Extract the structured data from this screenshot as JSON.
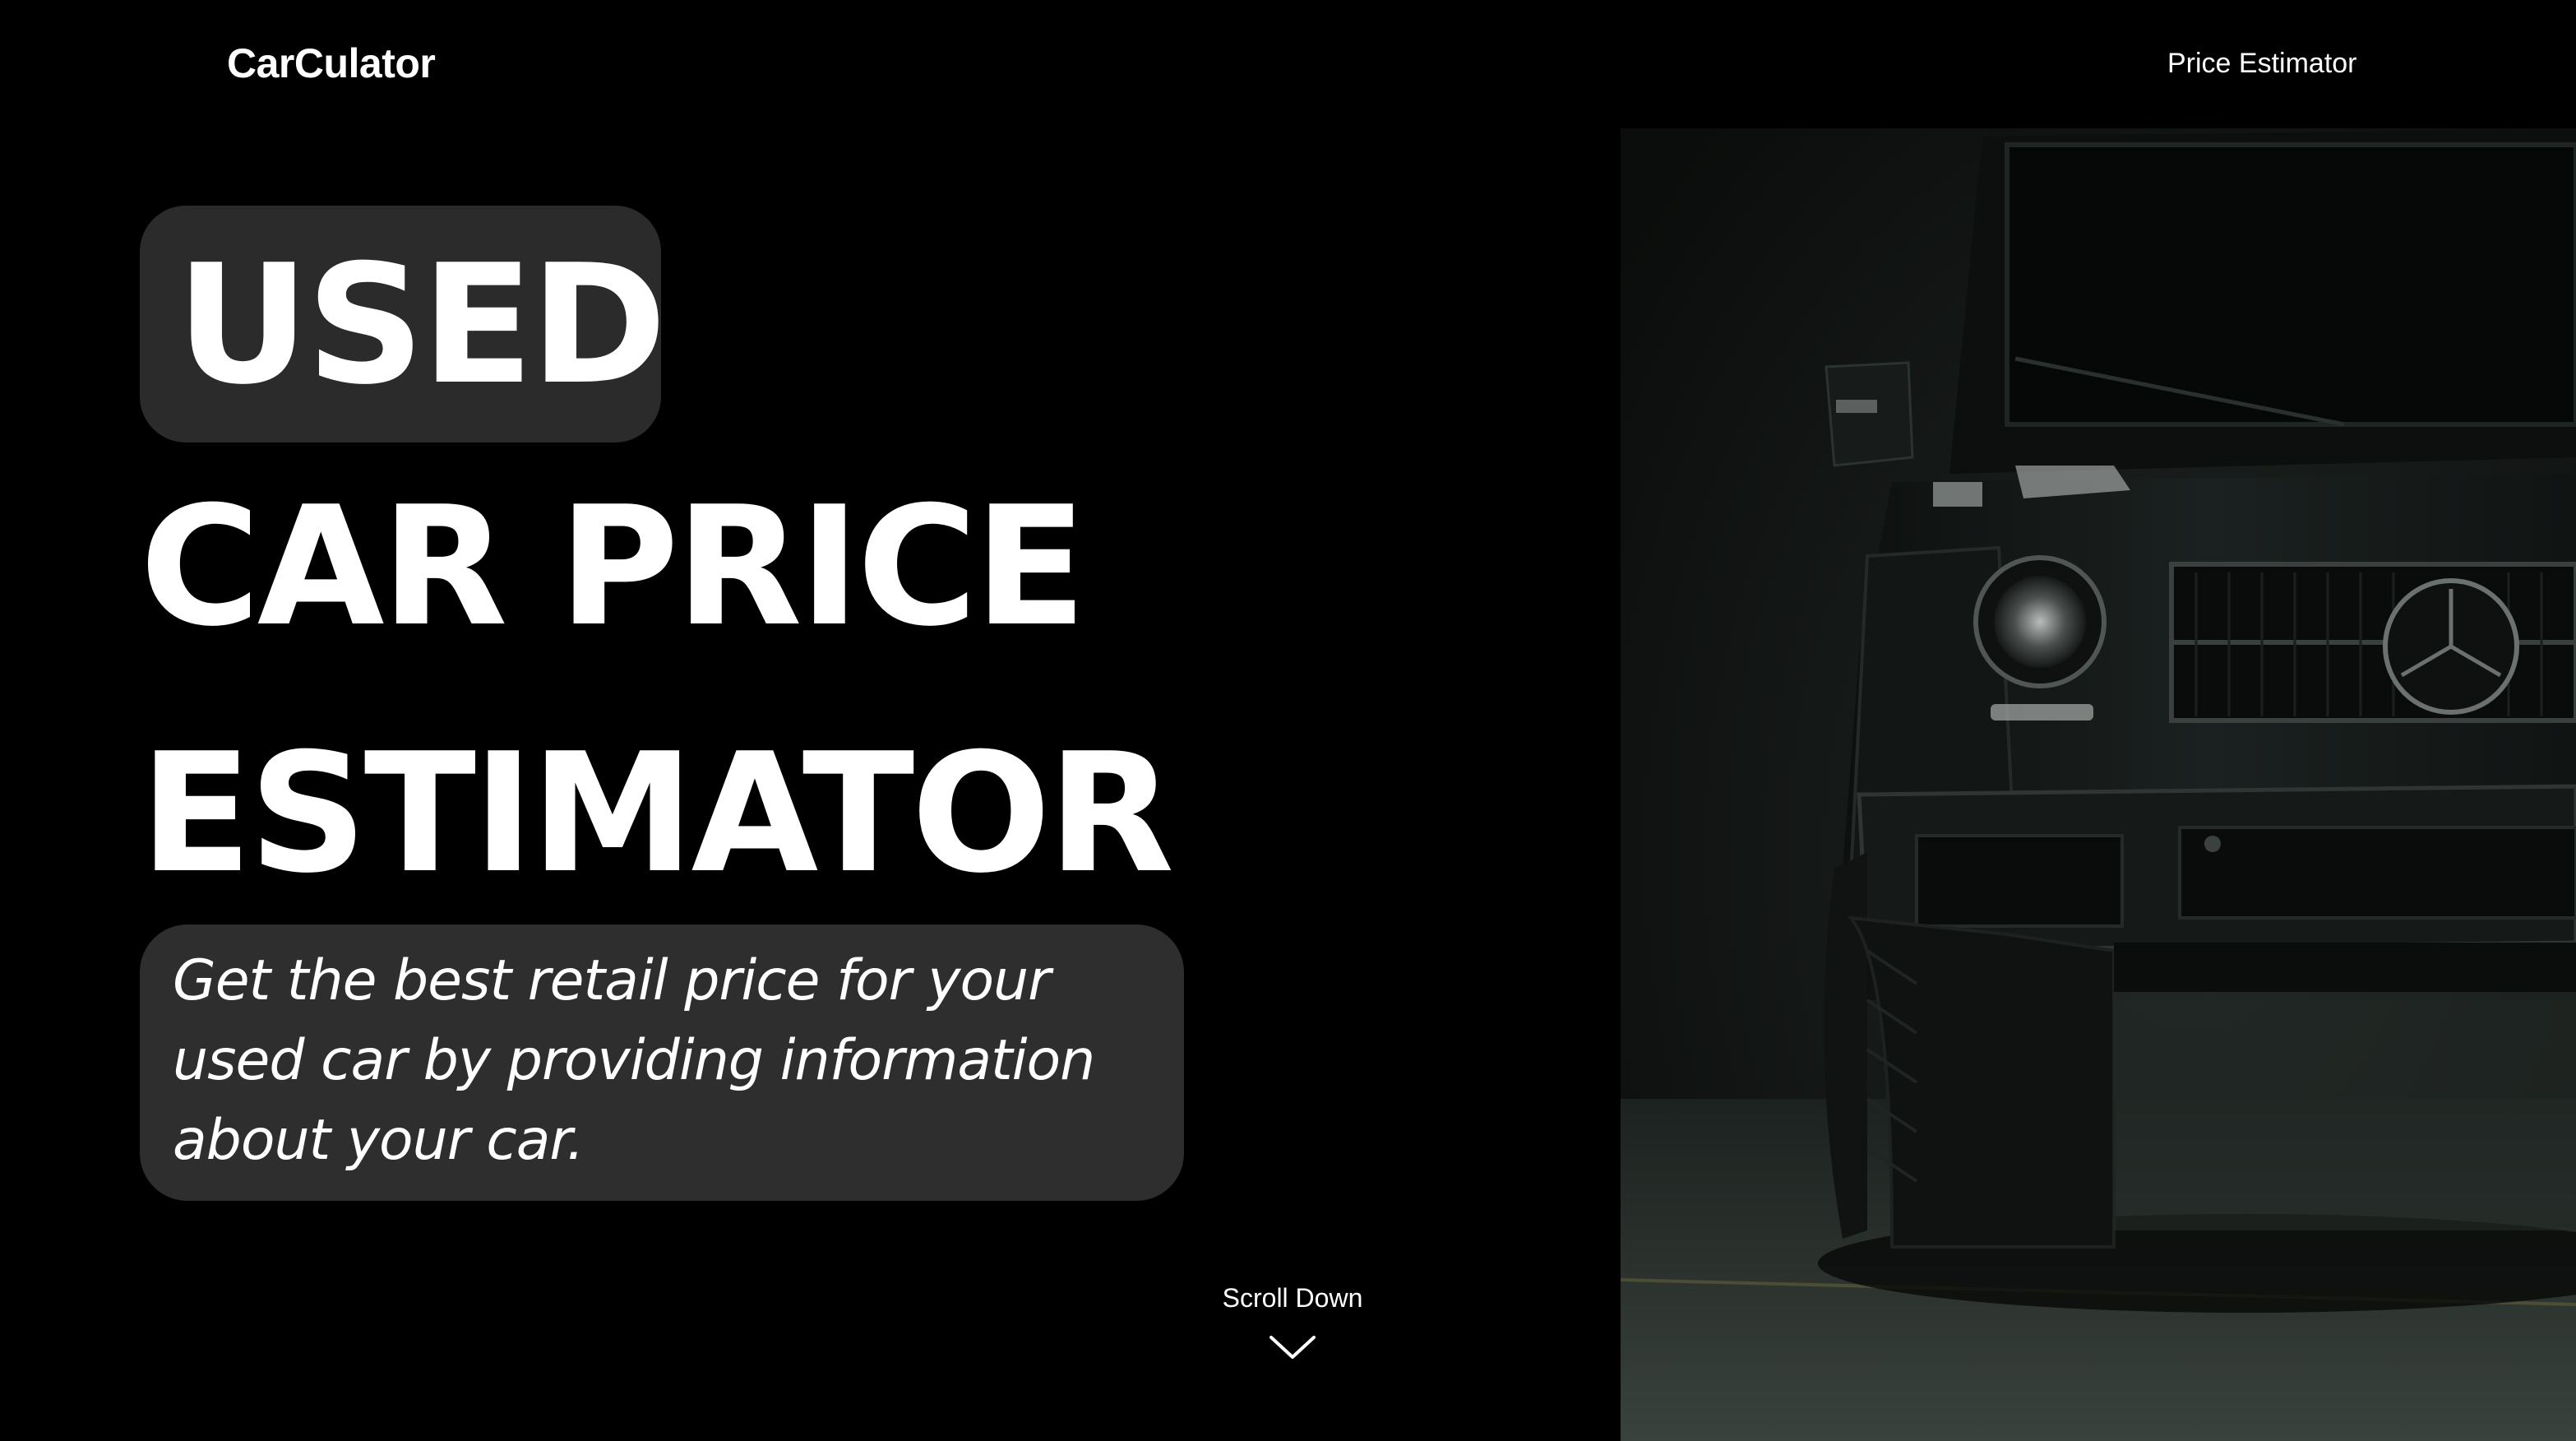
{
  "nav": {
    "brand": "CarCulator",
    "links": [
      "Price Estimator"
    ]
  },
  "hero": {
    "headline_line1": "USED",
    "headline_line2": "CAR PRICE",
    "headline_line3": "ESTIMATOR",
    "tagline": "Get the best retail price for your used car by providing information about your car."
  },
  "scroll": {
    "label": "Scroll Down",
    "icon": "chevron-down-icon"
  },
  "image": {
    "subject": "black-suv-photo"
  },
  "colors": {
    "background": "#000000",
    "text": "#ffffff",
    "pill": "#2b2b2b",
    "tagline_box": "#2e2e2e"
  }
}
